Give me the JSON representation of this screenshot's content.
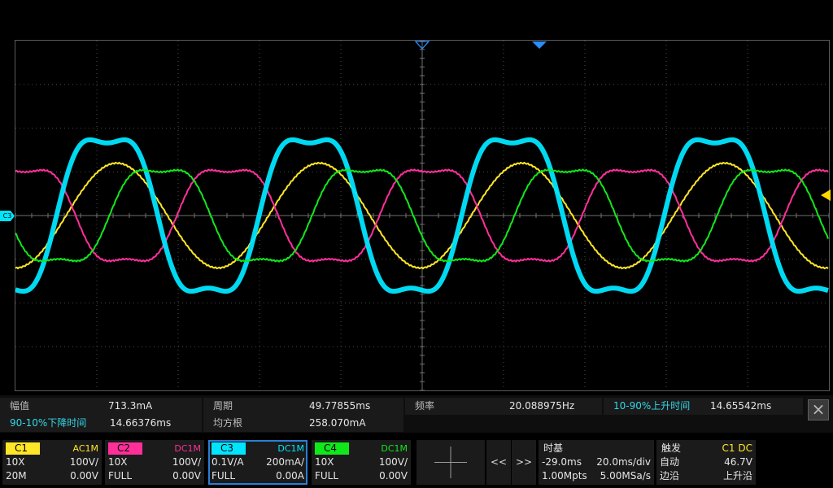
{
  "colors": {
    "ch1": "#ffe626",
    "ch2": "#ff2f9a",
    "ch3": "#00e5ff",
    "ch4": "#10e81a",
    "grid": "#4a4a4a",
    "accent": "#33d6e8"
  },
  "screen": {
    "ch3_marker_label": "C3"
  },
  "measurements": [
    {
      "name": "幅值",
      "value": "713.3mA"
    },
    {
      "name": "周期",
      "value": "49.77855ms"
    },
    {
      "name": "频率",
      "value": "20.088975Hz"
    },
    {
      "name": "10-90%上升时间",
      "value": "14.65542ms"
    },
    {
      "name": "90-10%下降时间",
      "value": "14.66376ms"
    },
    {
      "name": "均方根",
      "value": "258.070mA"
    }
  ],
  "close_icon": "×",
  "channels": [
    {
      "tag": "C1",
      "coupling": "AC1M",
      "probe": "10X",
      "scale": "100V/",
      "bw": "20M",
      "offset": "0.00V"
    },
    {
      "tag": "C2",
      "coupling": "DC1M",
      "probe": "10X",
      "scale": "100V/",
      "bw": "FULL",
      "offset": "0.00V"
    },
    {
      "tag": "C3",
      "coupling": "DC1M",
      "probe": "0.1V/A",
      "scale": "200mA/",
      "bw": "FULL",
      "offset": "0.00A"
    },
    {
      "tag": "C4",
      "coupling": "DC1M",
      "probe": "10X",
      "scale": "100V/",
      "bw": "FULL",
      "offset": "0.00V"
    }
  ],
  "nav": {
    "prev": "<<",
    "next": ">>"
  },
  "timebase": {
    "title": "时基",
    "delay": "-29.0ms",
    "scale": "20.0ms/div",
    "points": "1.00Mpts",
    "rate": "5.00MSa/s"
  },
  "trigger": {
    "title": "触发",
    "source": "C1 DC",
    "mode": "自动",
    "level": "46.7V",
    "type": "边沿",
    "slope": "上升沿"
  },
  "chart_data": {
    "type": "line",
    "xlabel": "",
    "ylabel": "",
    "x_divisions": 10,
    "y_divisions": 8,
    "period_divisions": 2.49,
    "series": [
      {
        "channel": "C1",
        "amplitude_div": 1.2,
        "phase_deg": -90,
        "shape": "sine"
      },
      {
        "channel": "C2",
        "amplitude_div": 1.2,
        "phase_deg": 73,
        "shape": "flat-top"
      },
      {
        "channel": "C3",
        "amplitude_div": 2.0,
        "phase_deg": -73,
        "shape": "flat-top"
      },
      {
        "channel": "C4",
        "amplitude_div": 1.2,
        "phase_deg": -167,
        "shape": "flat-top"
      }
    ]
  }
}
